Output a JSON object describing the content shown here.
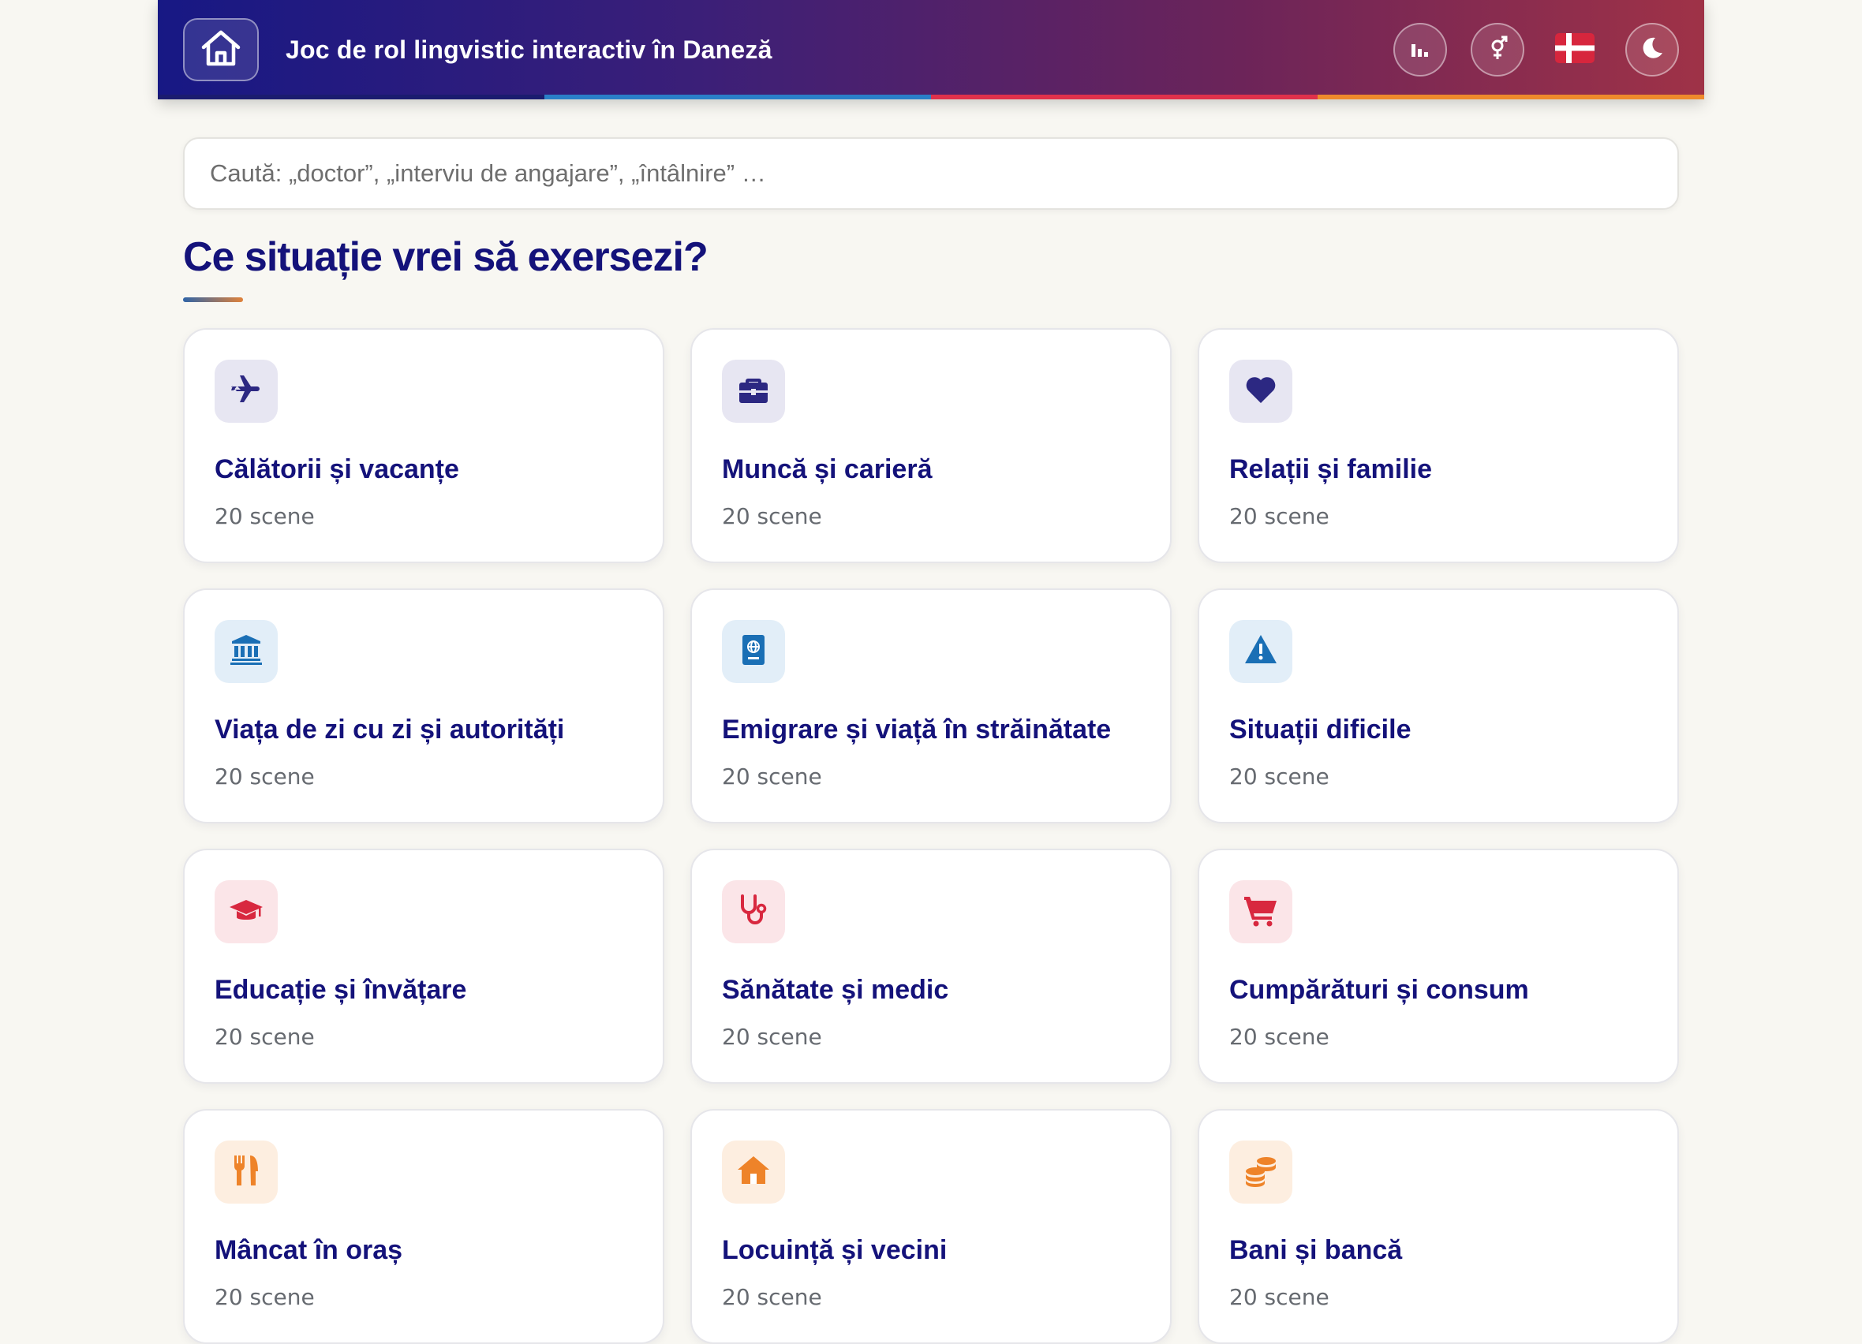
{
  "header": {
    "title": "Joc de rol lingvistic interactiv în Daneză",
    "stripe_colors": [
      "#1b1c6f",
      "#2a7fc8",
      "#e0314b",
      "#ee8a2c"
    ]
  },
  "search": {
    "placeholder": "Caută: „doctor”, „interviu de angajare”, „întâlnire” …"
  },
  "section": {
    "title": "Ce situație vrei să exersezi?"
  },
  "categories": [
    {
      "title": "Călătorii și vacanțe",
      "count": "20 scene",
      "icon": "airplane-icon",
      "tint": "#e7e6f2",
      "color": "#2c2882"
    },
    {
      "title": "Muncă și carieră",
      "count": "20 scene",
      "icon": "briefcase-icon",
      "tint": "#e7e6f2",
      "color": "#2c2882"
    },
    {
      "title": "Relații și familie",
      "count": "20 scene",
      "icon": "heart-icon",
      "tint": "#e7e6f2",
      "color": "#2c2882"
    },
    {
      "title": "Viața de zi cu zi și autorități",
      "count": "20 scene",
      "icon": "government-building-icon",
      "tint": "#e2eef8",
      "color": "#1a6fb5"
    },
    {
      "title": "Emigrare și viață în străinătate",
      "count": "20 scene",
      "icon": "passport-icon",
      "tint": "#e2eef8",
      "color": "#1a6fb5"
    },
    {
      "title": "Situații dificile",
      "count": "20 scene",
      "icon": "warning-icon",
      "tint": "#e2eef8",
      "color": "#1a6fb5"
    },
    {
      "title": "Educație și învățare",
      "count": "20 scene",
      "icon": "graduation-cap-icon",
      "tint": "#fbe5e8",
      "color": "#d8283f"
    },
    {
      "title": "Sănătate și medic",
      "count": "20 scene",
      "icon": "stethoscope-icon",
      "tint": "#fbe5e8",
      "color": "#d8283f"
    },
    {
      "title": "Cumpărături și consum",
      "count": "20 scene",
      "icon": "shopping-cart-icon",
      "tint": "#fbe5e8",
      "color": "#d8283f"
    },
    {
      "title": "Mâncat în oraș",
      "count": "20 scene",
      "icon": "utensils-icon",
      "tint": "#fdeee0",
      "color": "#ee8329"
    },
    {
      "title": "Locuință și vecini",
      "count": "20 scene",
      "icon": "house-icon",
      "tint": "#fdeee0",
      "color": "#ee8329"
    },
    {
      "title": "Bani și bancă",
      "count": "20 scene",
      "icon": "coins-icon",
      "tint": "#fdeee0",
      "color": "#ee8329"
    }
  ]
}
